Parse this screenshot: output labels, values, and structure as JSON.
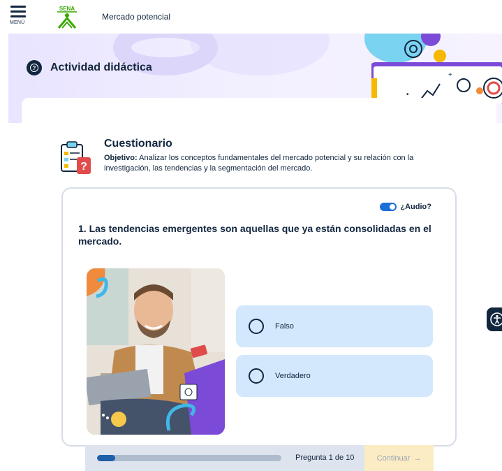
{
  "header": {
    "menu_label": "MENÚ",
    "logo_text": "SENA",
    "app_title": "Mercado potencial"
  },
  "banner": {
    "section_title": "Actividad didáctica"
  },
  "quiz": {
    "title": "Cuestionario",
    "objective_label": "Objetivo:",
    "objective_text": " Analizar los conceptos fundamentales del mercado potencial y su relación con la investigación, las tendencias y la segmentación del mercado.",
    "audio_label": "¿Audio?",
    "audio_enabled": true,
    "question": "1. Las tendencias emergentes son aquellas que ya están consolidadas en el mercado.",
    "options": [
      {
        "label": "Falso",
        "selected": false
      },
      {
        "label": "Verdadero",
        "selected": false
      }
    ]
  },
  "footer": {
    "progress_label": "Pregunta 1 de 10",
    "progress_fraction": 0.1,
    "continue_label": "Continuar",
    "continue_arrow": "→"
  },
  "colors": {
    "navy": "#12263f",
    "option_bg": "#d3e8fc",
    "progress_fill": "#1d5fab",
    "continue_bg": "#fcecc4",
    "sena_green": "#39a900"
  },
  "icons": [
    "menu-icon",
    "sena-logo",
    "question-circle-icon",
    "quiz-clipboard-icon",
    "audio-toggle",
    "accessibility-icon"
  ]
}
